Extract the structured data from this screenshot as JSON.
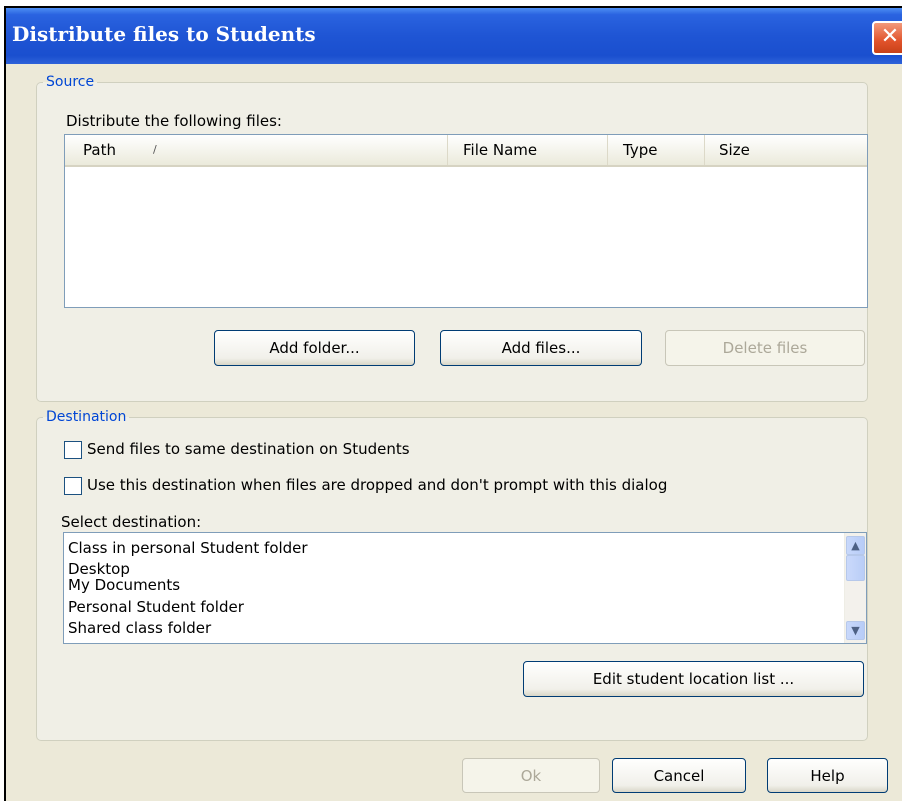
{
  "window": {
    "title": "Distribute files to Students"
  },
  "source": {
    "legend": "Source",
    "files_label": "Distribute the following files:",
    "columns": [
      "Path",
      "File Name",
      "Type",
      "Size"
    ],
    "sort_indicator": "/",
    "rows": [],
    "buttons": {
      "add_folder": "Add folder...",
      "add_files": "Add files...",
      "delete_files": "Delete files"
    }
  },
  "destination": {
    "legend": "Destination",
    "checkbox_same_dest": {
      "label": "Send files to same destination on Students",
      "checked": false
    },
    "checkbox_use_dest": {
      "label": "Use this destination when files are dropped and don't prompt with this dialog",
      "checked": false
    },
    "select_label": "Select destination:",
    "options": [
      "Class in personal Student folder",
      "Desktop",
      "My Documents",
      "Personal Student folder",
      "Shared class folder"
    ],
    "edit_button": "Edit student location list ..."
  },
  "footer": {
    "ok": "Ok",
    "cancel": "Cancel",
    "help": "Help"
  },
  "icons": {
    "close": "close-icon",
    "scroll_up": "scroll-up-icon",
    "scroll_down": "scroll-down-icon"
  }
}
